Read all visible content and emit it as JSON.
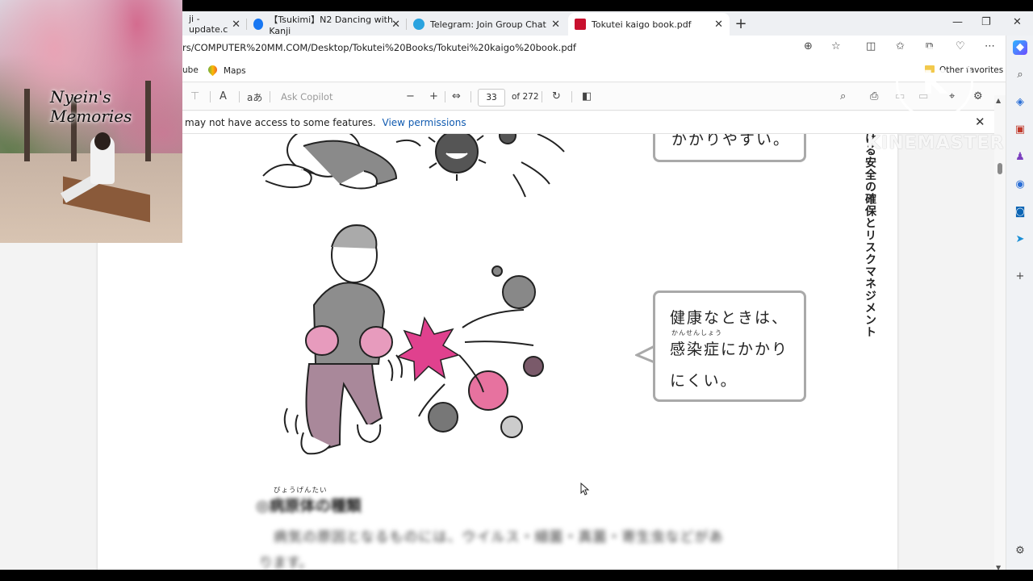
{
  "browser": {
    "tabs": [
      {
        "label": "ji - update.c",
        "active": false
      },
      {
        "label": "【Tsukimi】N2 Dancing with Kanji",
        "active": false
      },
      {
        "label": "Telegram: Join Group Chat",
        "active": false
      },
      {
        "label": "Tokutei kaigo book.pdf",
        "active": true
      }
    ],
    "new_tab_label": "+",
    "url": "rs/COMPUTER%20MM.COM/Desktop/Tokutei%20Books/Tokutei%20kaigo%20book.pdf",
    "favorites": [
      {
        "label": "ube"
      },
      {
        "label": "Maps"
      }
    ],
    "other_favorites": "Other favorites"
  },
  "pdf_toolbar": {
    "ask_copilot": "Ask Copilot",
    "zoom_out": "−",
    "zoom_in": "+",
    "read_aloud": "A",
    "translate": "aあ",
    "current_page": "33",
    "total_pages": "of 272"
  },
  "infobar": {
    "message": "may not have access to some features.",
    "link": "View permissions",
    "close": "✕"
  },
  "document": {
    "bubble_top": "かかりやすい。",
    "bubble_main": {
      "line1": "健康なときは、",
      "ruby": "かんせんしょう",
      "line2": "感染症にかかり",
      "line3": "にくい。"
    },
    "vertical_title": "ける安全の確保とリスクマネジメント",
    "section_ruby": "びょうげんたい",
    "section_heading": "◎病原体の種類",
    "section_body1": "病気の原因となるものには、ウイルス・細菌・真菌・寄生虫などがあ",
    "section_body2": "ります。"
  },
  "overlay": {
    "title": "Nyein's Memories"
  },
  "watermark": {
    "logo_letter": "K",
    "text": "KINEMASTER"
  },
  "colors": {
    "pink": "#e0418e",
    "mauve": "#a9889a",
    "link": "#0f5ab0"
  }
}
